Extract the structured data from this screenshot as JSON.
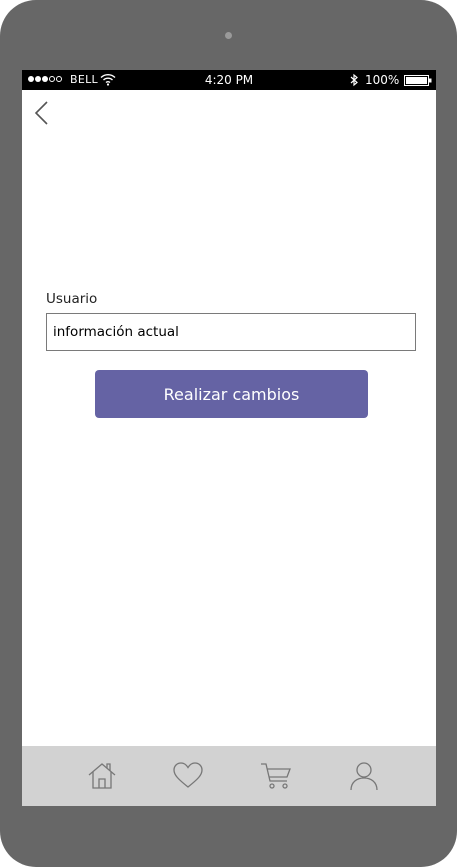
{
  "status_bar": {
    "carrier": "BELL",
    "time": "4:20 PM",
    "battery": "100%",
    "signal_bars_filled": 3,
    "signal_bars_total": 5
  },
  "nav": {
    "back_icon": "chevron-left-icon"
  },
  "form": {
    "username_label": "Usuario",
    "username_value": "información actual",
    "submit_label": "Realizar cambios"
  },
  "tab_bar": {
    "items": [
      {
        "icon": "home-icon"
      },
      {
        "icon": "heart-icon"
      },
      {
        "icon": "cart-icon"
      },
      {
        "icon": "user-icon"
      }
    ]
  },
  "colors": {
    "device_frame": "#676767",
    "status_bar": "#000000",
    "accent": "#6563a4",
    "tab_bar": "#d2d2d2",
    "icon_stroke": "#777777"
  }
}
